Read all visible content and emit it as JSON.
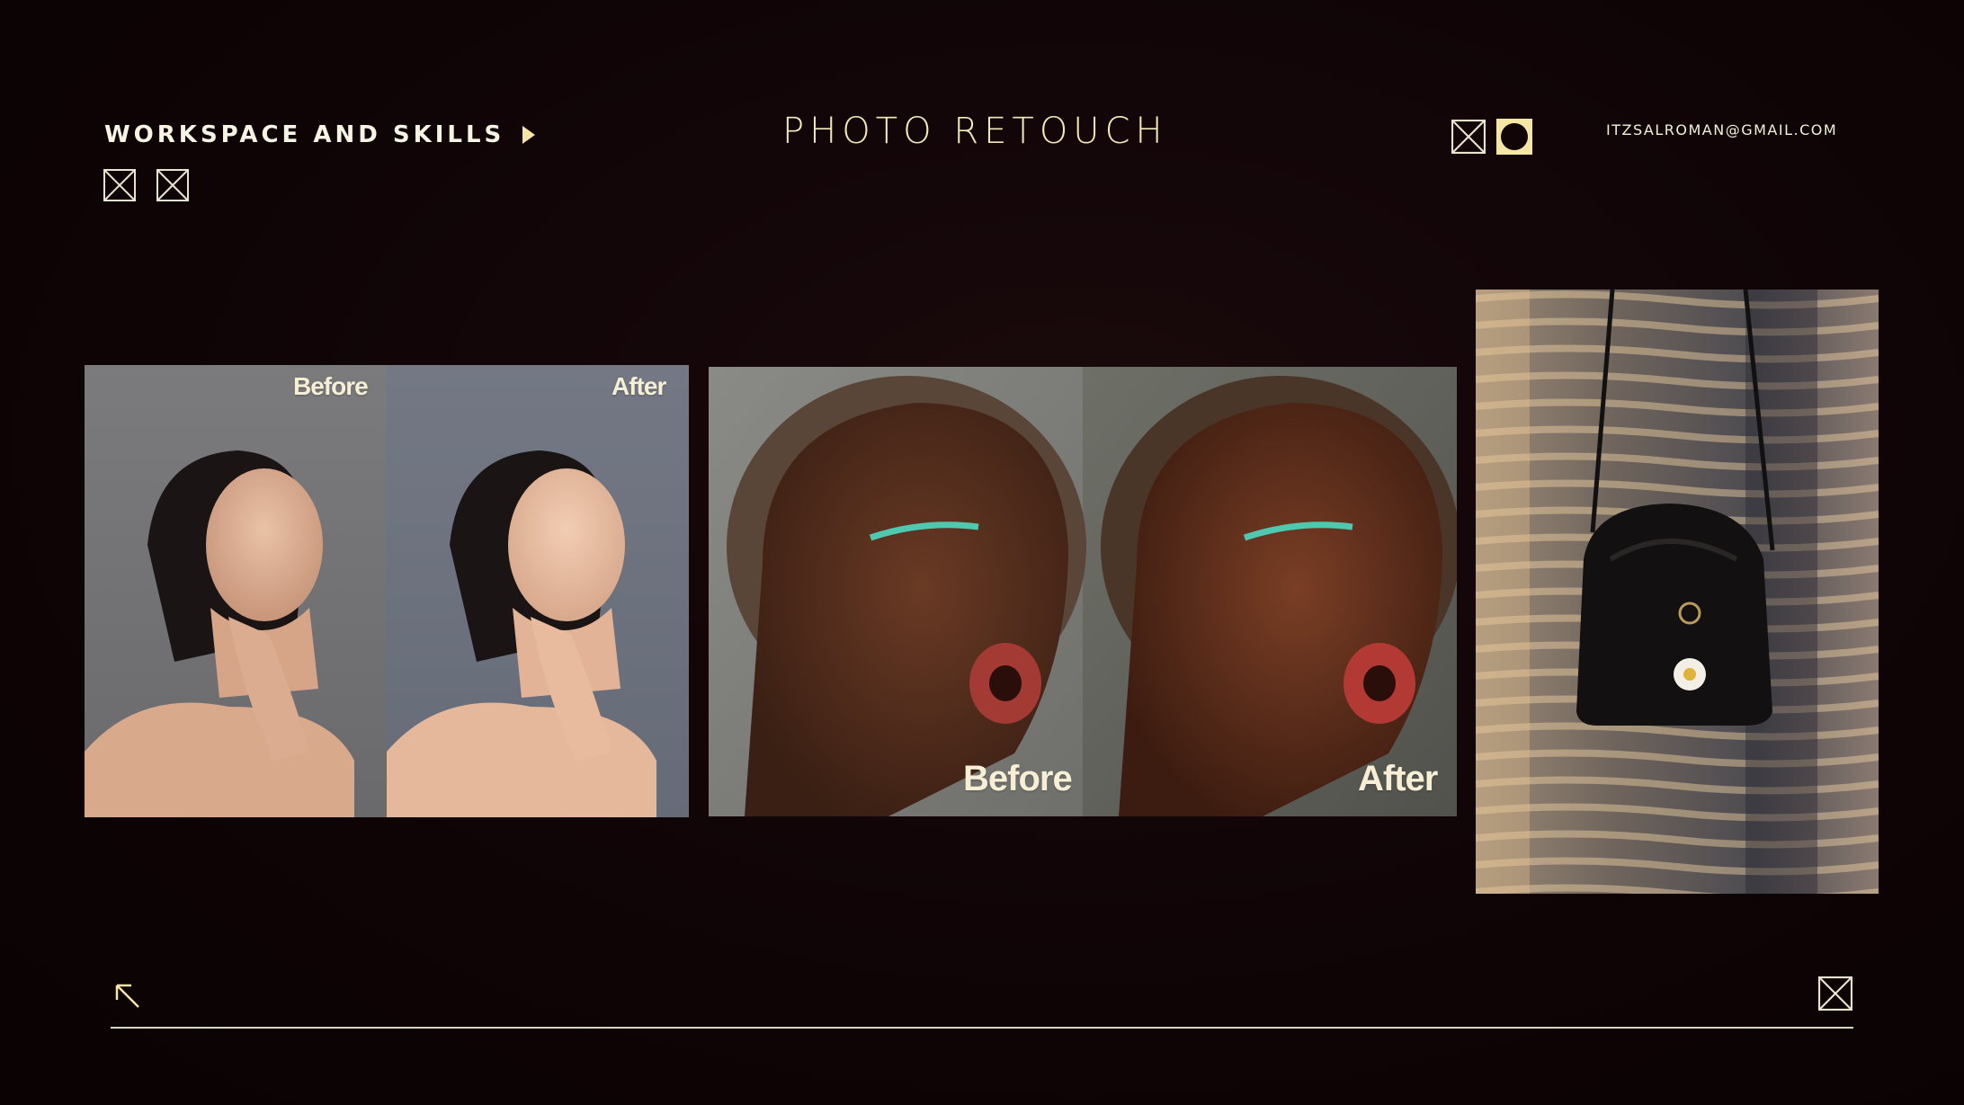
{
  "header": {
    "section_label": "WORKSPACE AND SKILLS",
    "title": "PHOTO RETOUCH",
    "email": "ITZSALROMAN@GMAIL.COM"
  },
  "panels": {
    "portrait1": {
      "before": "Before",
      "after": "After"
    },
    "portrait2": {
      "before": "Before",
      "after": "After"
    }
  },
  "icons": {
    "section_arrow": "play-icon",
    "placeholder": "image-placeholder-icon",
    "circle_badge": "circle-badge-icon",
    "back_arrow": "arrow-up-left-icon"
  },
  "colors": {
    "accent": "#f4e7a6",
    "background": "#0f0406",
    "text": "#f3f0d6"
  }
}
